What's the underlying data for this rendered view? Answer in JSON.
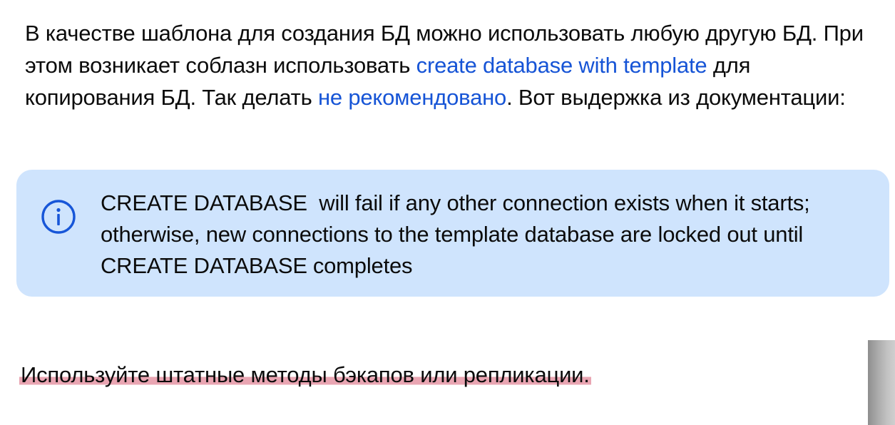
{
  "intro": {
    "text_1": "В качестве шаблона для создания БД можно использовать любую другую БД. При этом возникает соблазн использовать ",
    "link_1": "create database with template",
    "text_2": " для копирования БД. Так делать ",
    "link_2": "не рекомендовано",
    "text_3": ". Вот выдержка из документации:"
  },
  "note": {
    "icon": "info-icon",
    "code_1": "CREATE DATABASE",
    "text_1": " will fail if any other connection exists when it starts; otherwise, new connections to the template database are locked out until ",
    "code_2": "CREATE DATABASE",
    "text_2": "completes"
  },
  "tip": {
    "text": "Используйте штатные методы бэкапов или репликации."
  },
  "colors": {
    "link": "#1654d6",
    "note_background": "#cfe4fd",
    "note_icon": "#1756d8",
    "tip_highlight": "#e9a5b2"
  }
}
